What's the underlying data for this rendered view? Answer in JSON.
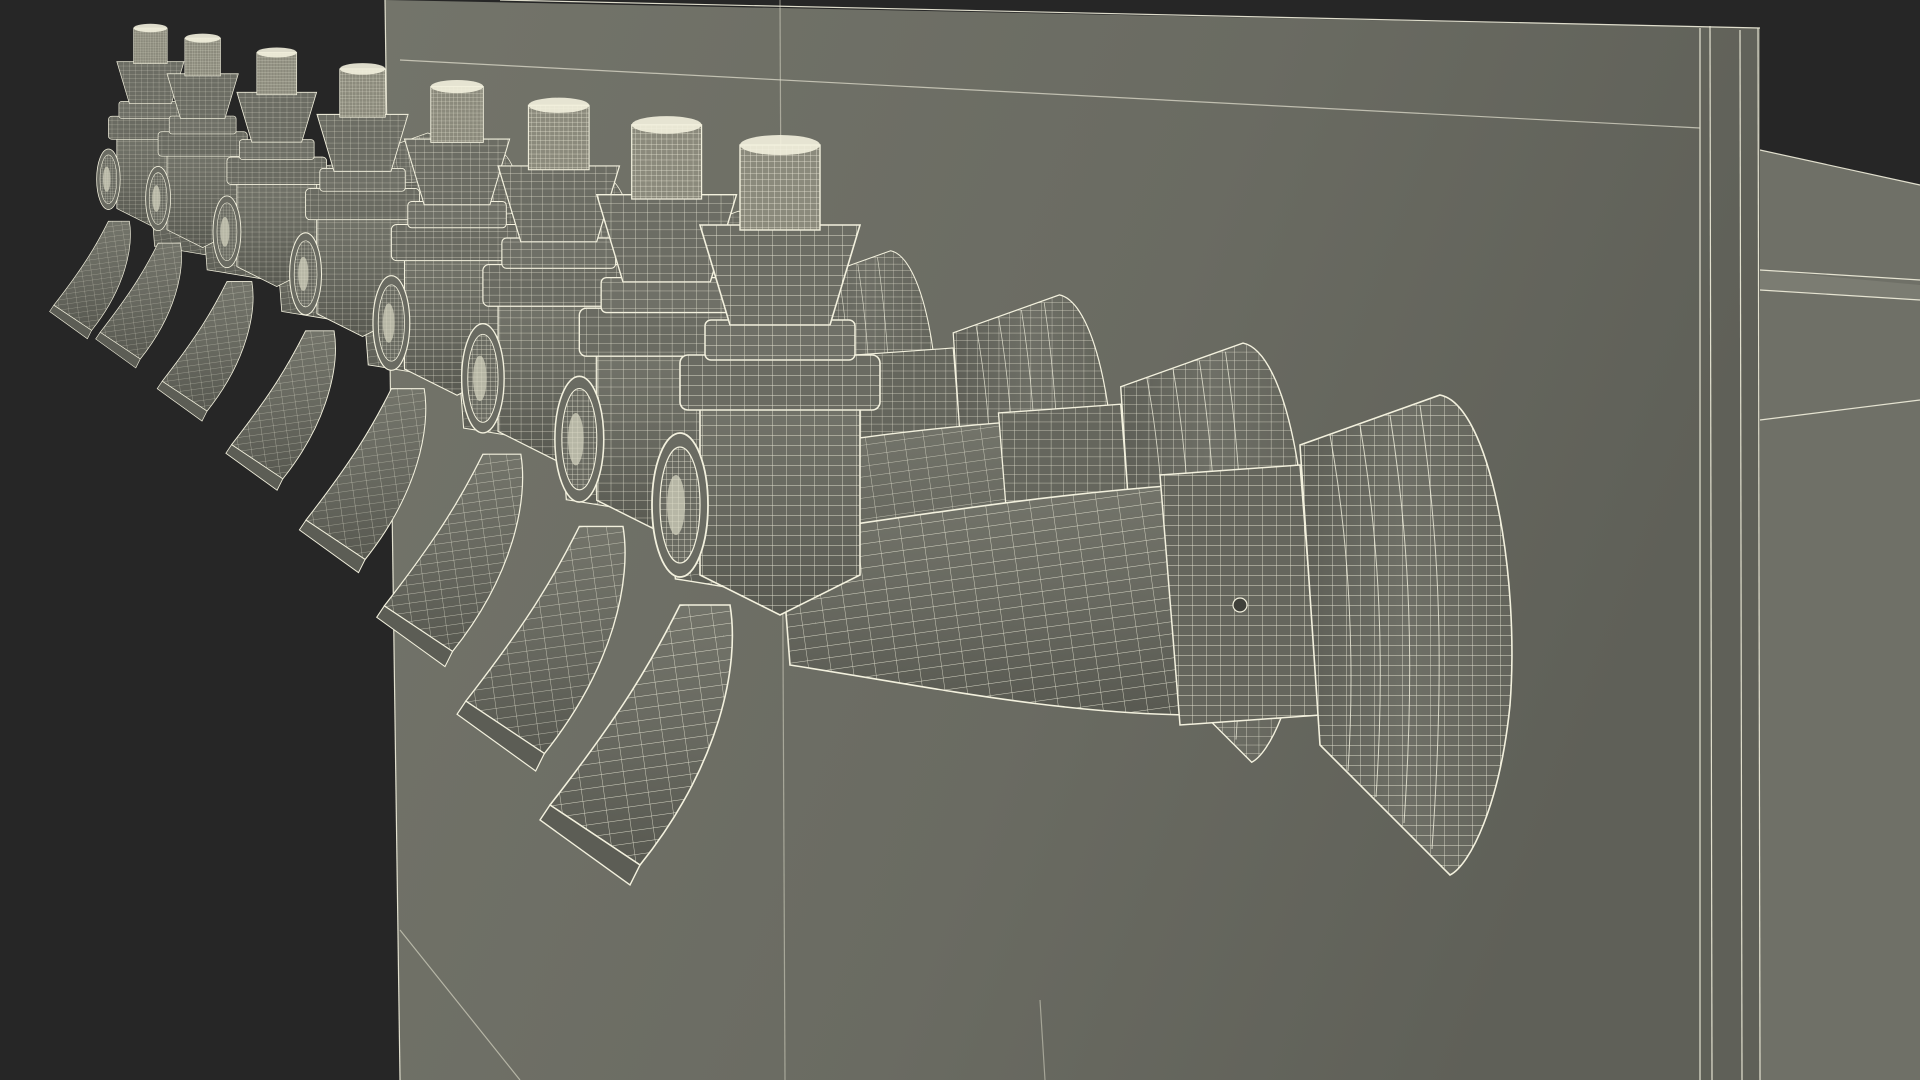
{
  "scene": {
    "subject": "wireframe-render",
    "tap_count": 8,
    "colors": {
      "background": "#262626",
      "panel": "#6b6c63",
      "panel_dark": "#5c5d55",
      "panel_light": "#76776d",
      "tap_body": "#6a6b62",
      "tap_shadow": "#55564f",
      "wire": "#f3f1de",
      "wire_dim": "#c9c7b4"
    }
  }
}
